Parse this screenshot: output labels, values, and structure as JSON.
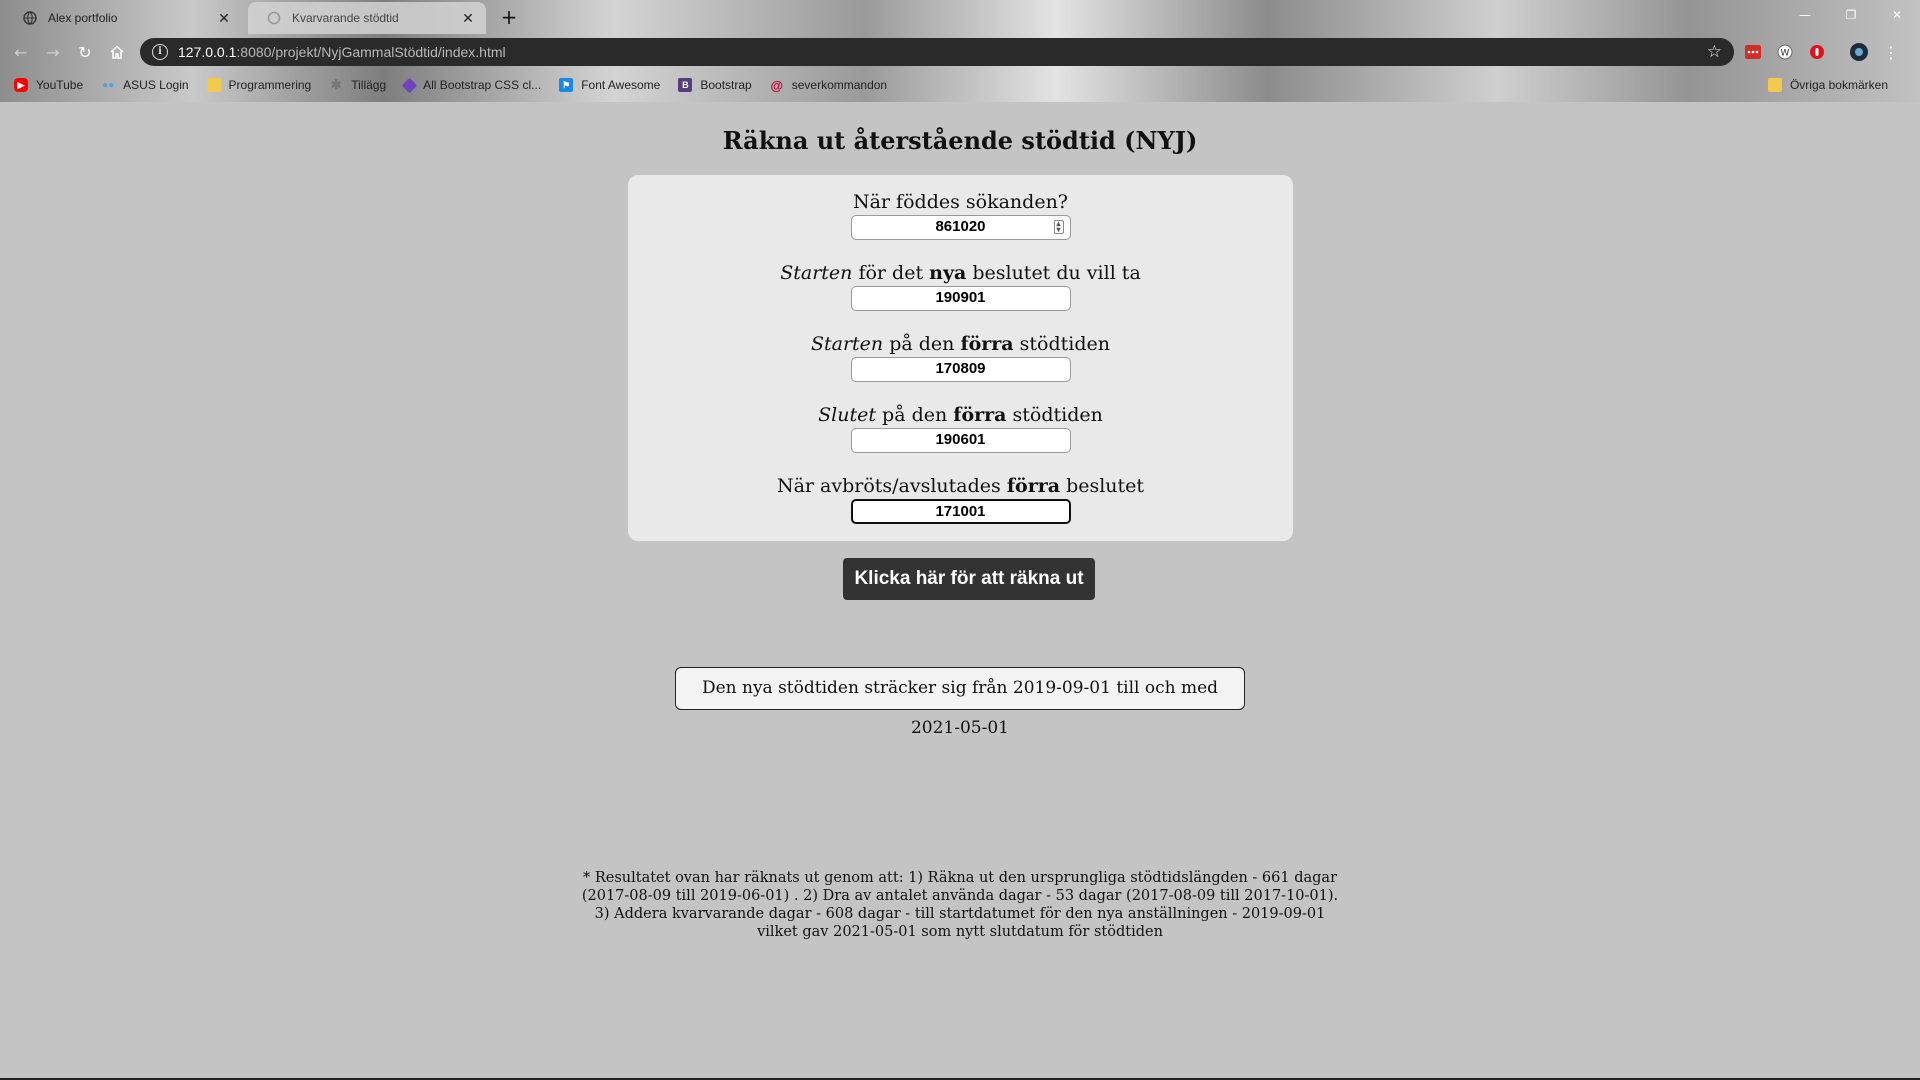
{
  "browser": {
    "tabs": [
      {
        "title": "Alex portfolio",
        "icon": "globe-icon",
        "active": false
      },
      {
        "title": "Kvarvarande stödtid",
        "icon": "loading-icon",
        "active": true
      }
    ],
    "url_host": "127.0.0.1",
    "url_path": ":8080/projekt/NyjGammalStödtid/index.html",
    "bookmarks": [
      {
        "label": "YouTube",
        "icon": "youtube-icon",
        "color": "#ff0000"
      },
      {
        "label": "ASUS Login",
        "icon": "asus-icon",
        "color": "#5aa0d8"
      },
      {
        "label": "Programmering",
        "icon": "folder-icon",
        "color": "#f2c94c"
      },
      {
        "label": "Tillägg",
        "icon": "puzzle-icon",
        "color": "#777777"
      },
      {
        "label": "All Bootstrap CSS cl...",
        "icon": "bootstrap-icon",
        "color": "#6f42c1"
      },
      {
        "label": "Font Awesome",
        "icon": "flag-icon",
        "color": "#1c88e6"
      },
      {
        "label": "Bootstrap",
        "icon": "bootstrap-b-icon",
        "color": "#563d7c"
      },
      {
        "label": "severkommandon",
        "icon": "debian-icon",
        "color": "#c70036"
      }
    ],
    "other_bookmarks": "Övriga bokmärken"
  },
  "page": {
    "title": "Räkna ut återstående stödtid (NYJ)",
    "fields": [
      {
        "label_parts": [
          {
            "t": "När föddes sökanden?",
            "s": "n"
          }
        ],
        "value": "861020"
      },
      {
        "label_parts": [
          {
            "t": "Starten",
            "s": "i"
          },
          {
            "t": " för det ",
            "s": "n"
          },
          {
            "t": "nya",
            "s": "b"
          },
          {
            "t": " beslutet du vill ta",
            "s": "n"
          }
        ],
        "value": "190901"
      },
      {
        "label_parts": [
          {
            "t": "Starten",
            "s": "i"
          },
          {
            "t": " på den ",
            "s": "n"
          },
          {
            "t": "förra",
            "s": "b"
          },
          {
            "t": " stödtiden",
            "s": "n"
          }
        ],
        "value": "170809"
      },
      {
        "label_parts": [
          {
            "t": "Slutet",
            "s": "i"
          },
          {
            "t": " på den ",
            "s": "n"
          },
          {
            "t": "förra",
            "s": "b"
          },
          {
            "t": " stödtiden",
            "s": "n"
          }
        ],
        "value": "190601"
      },
      {
        "label_parts": [
          {
            "t": "När avbröts/avslutades ",
            "s": "n"
          },
          {
            "t": "förra",
            "s": "b"
          },
          {
            "t": " beslutet",
            "s": "n"
          }
        ],
        "value": "171001"
      }
    ],
    "button_label": "Klicka här för att räkna ut",
    "result_text": "Den nya stödtiden sträcker sig från 2019-09-01 till och med 2021-05-01",
    "explanation": "* Resultatet ovan har räknats ut genom att: 1) Räkna ut den ursprungliga stödtidslängden - 661 dagar (2017-08-09 till 2019-06-01) . 2) Dra av antalet använda dagar - 53 dagar (2017-08-09 till 2017-10-01). 3) Addera kvarvarande dagar - 608 dagar - till startdatumet för den nya anställningen - 2019-09-01 vilket gav 2021-05-01 som nytt slutdatum för stödtiden"
  }
}
